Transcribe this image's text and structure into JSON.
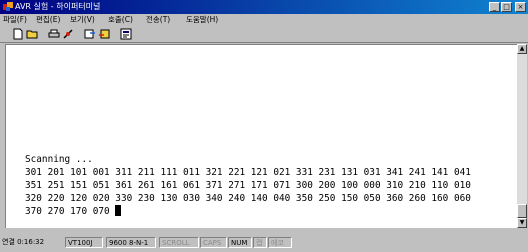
{
  "window": {
    "title": "AVR 실험 - 하이퍼터미널",
    "controls": [
      "_",
      "□",
      "×"
    ]
  },
  "menu": [
    "파일(F)",
    "편집(E)",
    "보기(V)",
    "호출(C)",
    "전송(T)",
    "도움말(H)"
  ],
  "toolbar": [
    "new-icon",
    "open-icon",
    "print-icon",
    "disconnect-icon",
    "send-icon",
    "receive-icon",
    "properties-icon"
  ],
  "terminal": {
    "lines": [
      "Scanning ...",
      "301 201 101 001 311 211 111 011 321 221 121 021 331 231 131 031 341 241 141 041",
      "351 251 151 051 361 261 161 061 371 271 171 071 300 200 100 000 310 210 110 010",
      "320 220 120 020 330 230 130 030 340 240 140 040 350 250 150 050 360 260 160 060"
    ],
    "last_line": "370 270 170 070 "
  },
  "status": {
    "connected": "연결 0:16:32",
    "emulation": "VT100J",
    "port": "9600 8-N-1",
    "scroll": "SCROLL",
    "caps": "CAPS",
    "num": "NUM",
    "capture": "캡",
    "echo": "에코"
  },
  "colors": {
    "titlebar_start": "#000080",
    "titlebar_end": "#1084d0",
    "face": "#c0c0c0",
    "terminal_bg": "#ffffff"
  }
}
